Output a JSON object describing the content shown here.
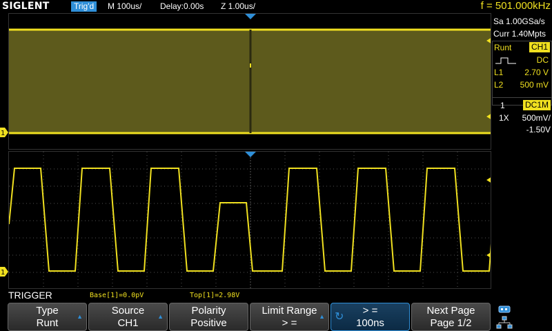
{
  "topbar": {
    "logo": "SIGLENT",
    "trigger_status": "Trig'd",
    "timebase": "M 100us/",
    "delay": "Delay:0.00s",
    "zoom_timebase": "Z 1.00us/",
    "frequency": "f = 501.000kHz"
  },
  "acquisition": {
    "sample_rate": "Sa 1.00GSa/s",
    "memory_depth": "Curr 1.40Mpts"
  },
  "trigger_info": {
    "type": "Runt",
    "source": "CH1",
    "coupling": "DC",
    "l1_label": "L1",
    "l1_value": "2.70 V",
    "l2_label": "L2",
    "l2_value": "500 mV"
  },
  "channel_info": {
    "number": "1",
    "coupling": "DC1M",
    "probe": "1X",
    "scale": "500mV/",
    "offset": "-1.50V"
  },
  "channel_marker": "1",
  "menu_title": "TRIGGER",
  "measurements": {
    "base": "Base[1]=0.0pV",
    "top": "Top[1]=2.98V"
  },
  "softkeys": [
    {
      "title": "Type",
      "value": "Runt"
    },
    {
      "title": "Source",
      "value": "CH1"
    },
    {
      "title": "Polarity",
      "value": "Positive"
    },
    {
      "title": "Limit Range",
      "value": "> ="
    },
    {
      "title": "> =",
      "value": "100ns"
    },
    {
      "title": "Next Page",
      "value": "Page 1/2"
    }
  ],
  "colors": {
    "channel1": "#f0e020",
    "accent": "#2f8fd8",
    "grid": "#555555"
  },
  "icons": {
    "trigger_position": "triangle-down-icon",
    "level_marker": "triangle-left-icon",
    "runt_symbol": "runt-pulse-icon",
    "adjust_knob": "rotate-knob-icon",
    "usb": "usb-icon",
    "network": "network-icon"
  }
}
